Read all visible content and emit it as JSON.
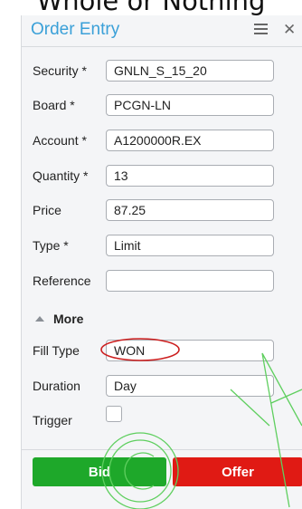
{
  "caption": "Whole or Nothing",
  "window": {
    "title": "Order Entry"
  },
  "icons": {
    "menu": "hamburger-menu-icon",
    "close": "close-x-icon",
    "collapse": "caret-up-icon"
  },
  "fields": {
    "security": {
      "label": "Security *",
      "value": "GNLN_S_15_20"
    },
    "board": {
      "label": "Board *",
      "value": "PCGN-LN"
    },
    "account": {
      "label": "Account *",
      "value": "A1200000R.EX"
    },
    "quantity": {
      "label": "Quantity *",
      "value": "13"
    },
    "price": {
      "label": "Price",
      "value": "87.25"
    },
    "type": {
      "label": "Type *",
      "value": "Limit"
    },
    "reference": {
      "label": "Reference",
      "value": ""
    }
  },
  "more": {
    "label": "More",
    "expanded": true
  },
  "more_fields": {
    "fill_type": {
      "label": "Fill Type",
      "value": "WON"
    },
    "duration": {
      "label": "Duration",
      "value": "Day"
    },
    "trigger": {
      "label": "Trigger",
      "checked": false
    }
  },
  "buttons": {
    "bid": "Bid",
    "offer": "Offer"
  },
  "colors": {
    "accent": "#3aa0d8",
    "bid": "#1ea82a",
    "offer": "#e01a14",
    "annotation_red": "#cc1f1f",
    "watermark_green": "#5fcf5f"
  }
}
